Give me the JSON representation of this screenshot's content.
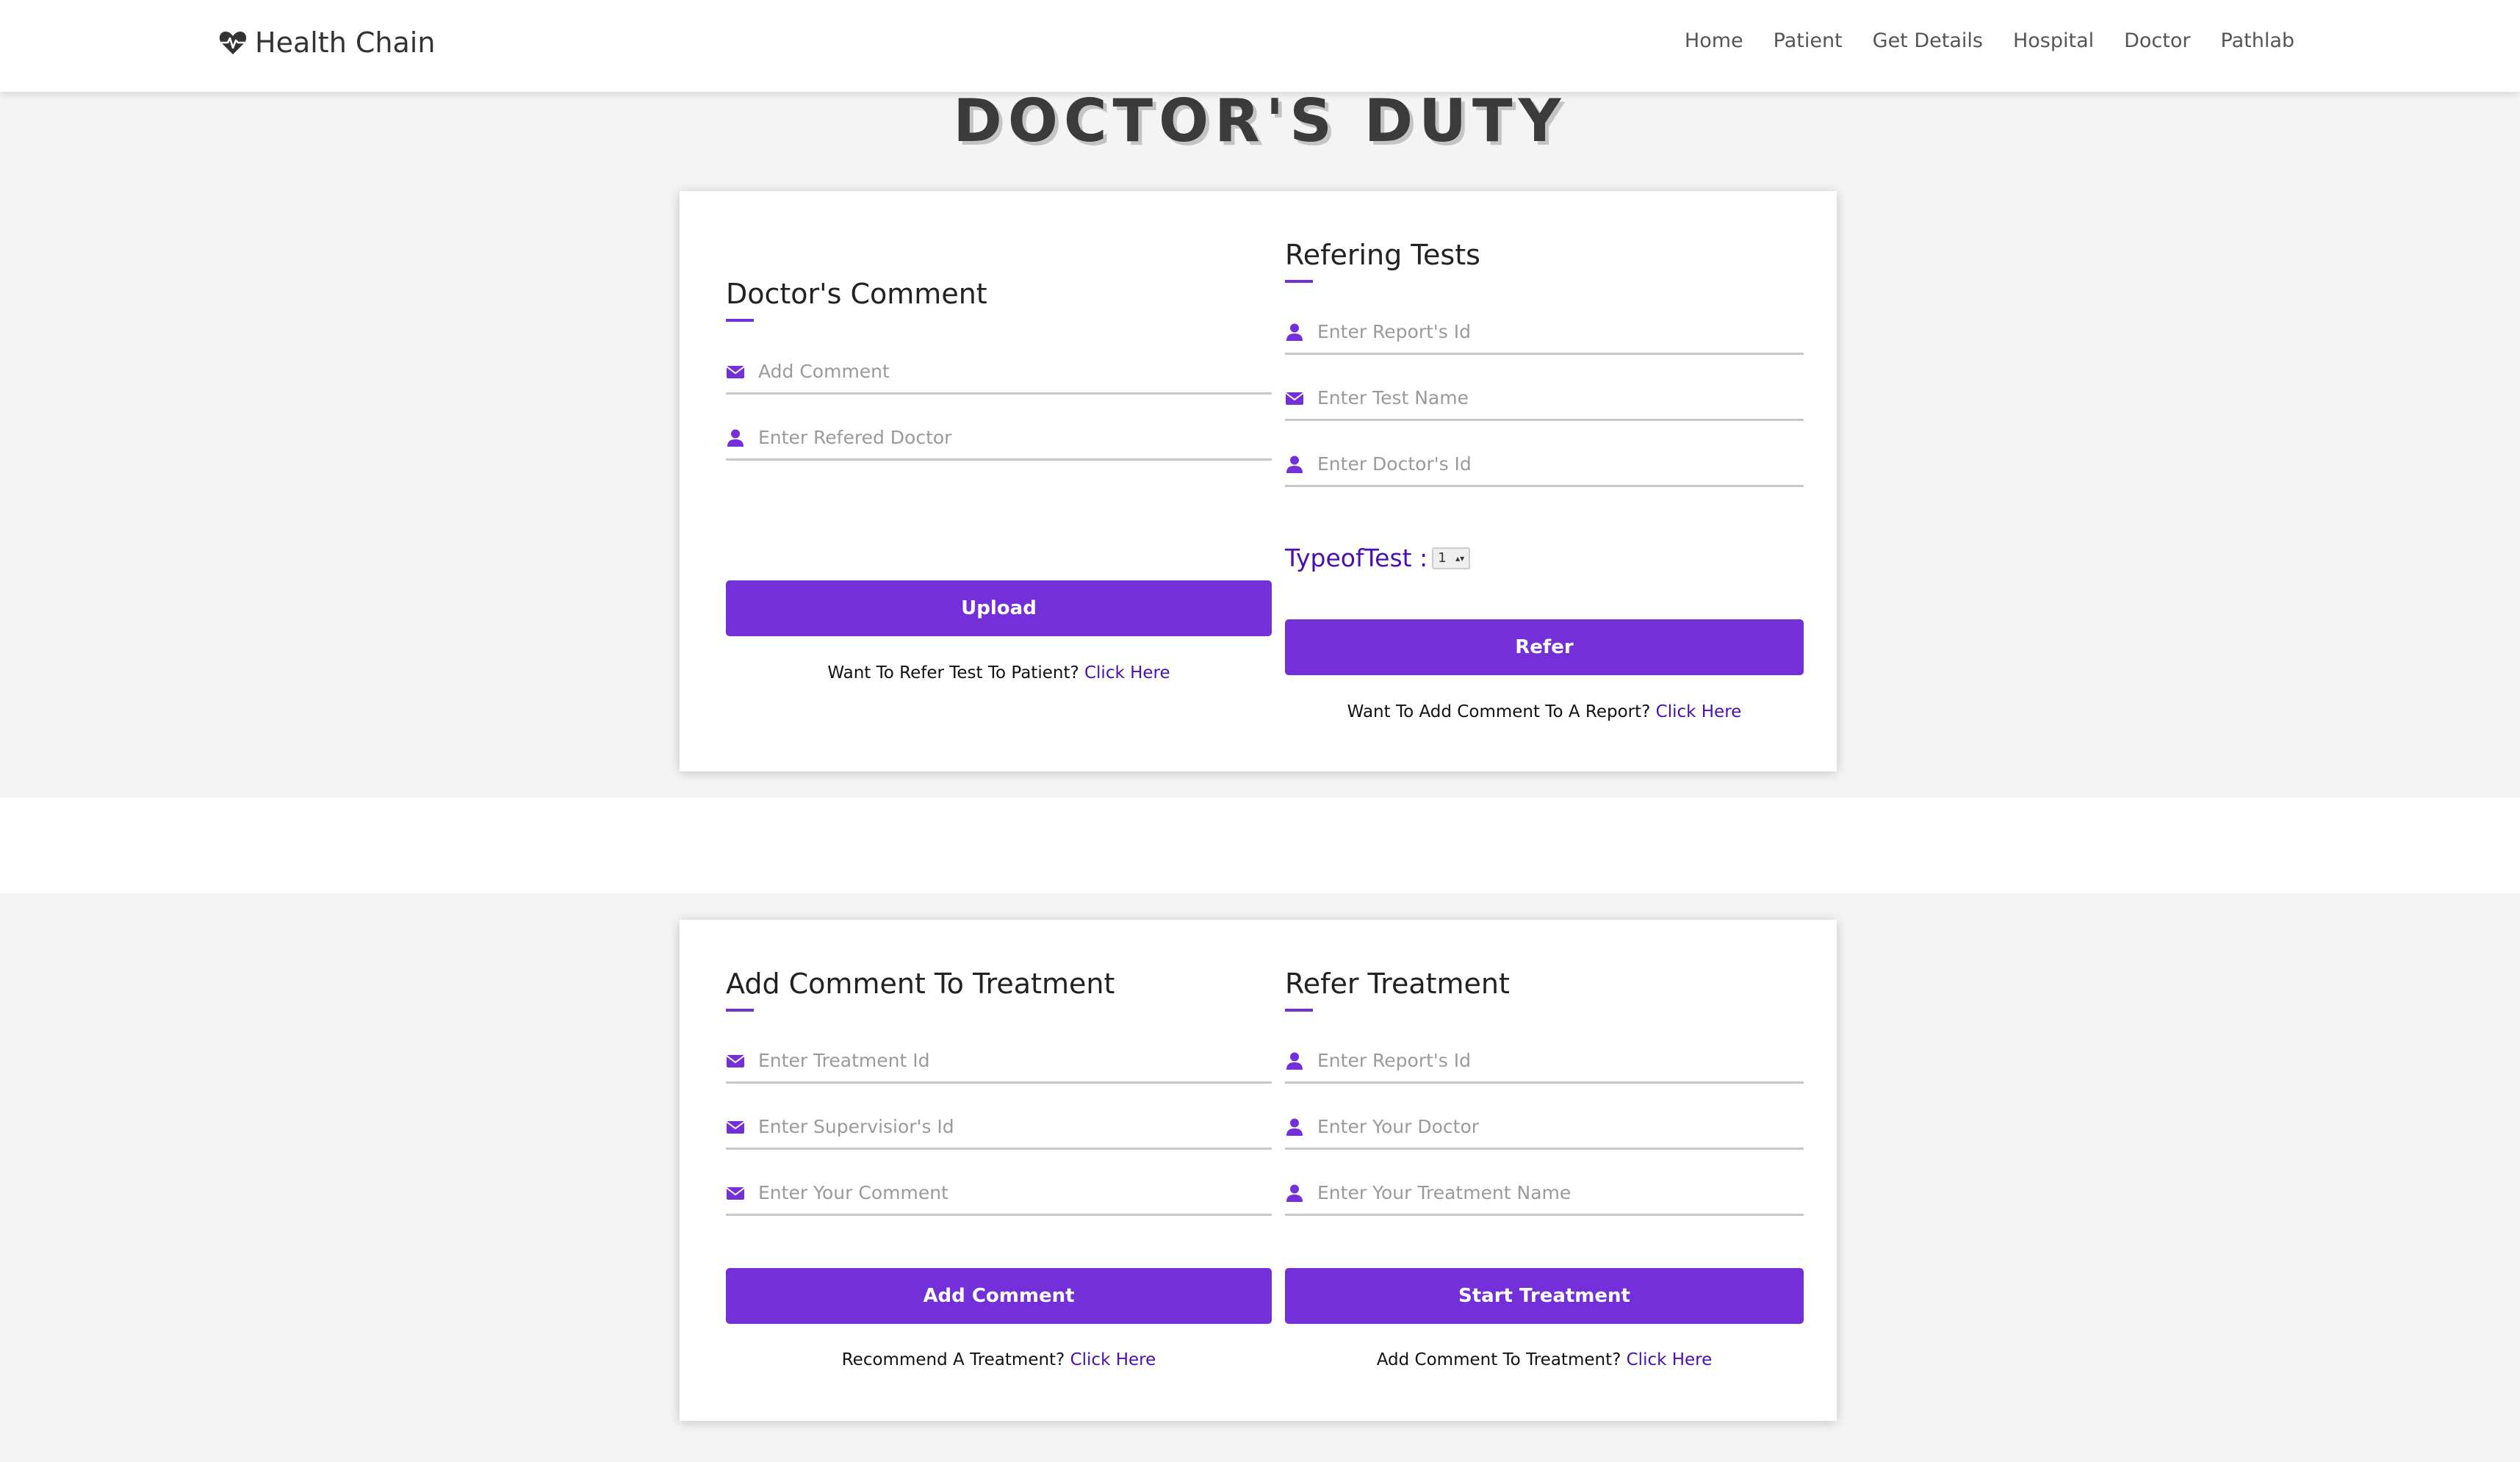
{
  "brand": {
    "name": "Health Chain",
    "icon": "heart-pulse-icon"
  },
  "nav": [
    "Home",
    "Patient",
    "Get Details",
    "Hospital",
    "Doctor",
    "Pathlab"
  ],
  "page_title": "DOCTOR'S DUTY",
  "colors": {
    "accent": "#7330d9",
    "link": "#4a0fb0",
    "background": "#f4f4f4"
  },
  "doctors_comment": {
    "title": "Doctor's Comment",
    "fields": [
      {
        "placeholder": "Add Comment",
        "icon": "envelope-icon"
      },
      {
        "placeholder": "Enter Refered Doctor",
        "icon": "user-icon"
      }
    ],
    "button": "Upload",
    "helper_text": "Want To Refer Test To Patient?",
    "helper_link": "Click Here"
  },
  "refering_tests": {
    "title": "Refering Tests",
    "fields": [
      {
        "placeholder": "Enter Report's Id",
        "icon": "user-icon"
      },
      {
        "placeholder": "Enter Test Name",
        "icon": "envelope-icon"
      },
      {
        "placeholder": "Enter Doctor's Id",
        "icon": "user-icon"
      }
    ],
    "type_label": "TypeofTest :",
    "type_value": "1",
    "button": "Refer",
    "helper_text": "Want To Add Comment To A Report?",
    "helper_link": "Click Here"
  },
  "add_comment_treatment": {
    "title": "Add Comment To Treatment",
    "fields": [
      {
        "placeholder": "Enter Treatment Id",
        "icon": "envelope-icon"
      },
      {
        "placeholder": "Enter Supervisior's Id",
        "icon": "envelope-icon"
      },
      {
        "placeholder": "Enter Your Comment",
        "icon": "envelope-icon"
      }
    ],
    "button": "Add Comment",
    "helper_text": "Recommend A Treatment?",
    "helper_link": "Click Here"
  },
  "refer_treatment": {
    "title": "Refer Treatment",
    "fields": [
      {
        "placeholder": "Enter Report's Id",
        "icon": "user-icon"
      },
      {
        "placeholder": "Enter Your Doctor",
        "icon": "user-icon"
      },
      {
        "placeholder": "Enter Your Treatment Name",
        "icon": "user-icon"
      }
    ],
    "button": "Start Treatment",
    "helper_text": "Add Comment To Treatment?",
    "helper_link": "Click Here"
  }
}
